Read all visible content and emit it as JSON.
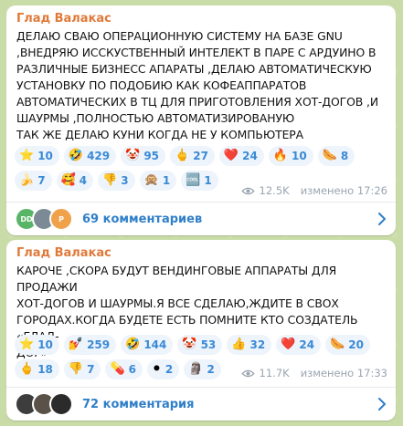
{
  "messages": [
    {
      "author": "Глад Валакас",
      "text": "ДЕЛАЮ СВАЮ ОПЕРАЦИОННУЮ СИСТЕМУ НА БАЗЕ GNU\n,ВНЕДРЯЮ ИССКУСТВЕННЫЙ ИНТЕЛЕКТ В ПАРЕ С АРДУИНО В\nРАЗЛИЧНЫЕ БИЗНЕСС АПАРАТЫ ,ДЕЛАЮ АВТОМАТИЧЕСКУЮ\nУСТАНОВКУ ПО ПОДОБИЮ КАК КОФЕАППАРАТОВ\nАВТОМАТИЧЕСКИХ В ТЦ ДЛЯ ПРИГОТОВЛЕНИЯ ХОТ-ДОГОВ ,И\nШАУРМЫ ,ПОЛНОСТЬЮ АВТОМАТИЗИРОВАНУЮ\nТАК ЖЕ ДЕЛАЮ КУНИ КОГДА НЕ У КОМПЬЮТЕРА",
      "reactions": [
        {
          "emoji": "⭐",
          "count": "10"
        },
        {
          "emoji": "🤣",
          "count": "429"
        },
        {
          "emoji": "🤡",
          "count": "95"
        },
        {
          "emoji": "🖕",
          "count": "27"
        },
        {
          "emoji": "❤️",
          "count": "24"
        },
        {
          "emoji": "🔥",
          "count": "10"
        },
        {
          "emoji": "🌭",
          "count": "8"
        },
        {
          "emoji": "🍌",
          "count": "7"
        },
        {
          "emoji": "🥰",
          "count": "4"
        },
        {
          "emoji": "👎",
          "count": "3"
        },
        {
          "emoji": "🙊",
          "count": "1"
        },
        {
          "emoji": "🆒",
          "count": "1"
        }
      ],
      "views": "12.5K",
      "edited_time": "изменено 17:26",
      "comments_label": "69 комментариев",
      "avatars": [
        {
          "initials": "DD",
          "color": "#58b567"
        },
        {
          "initials": "",
          "color": "#7c8a95"
        },
        {
          "initials": "P",
          "color": "#f0a24a"
        }
      ]
    },
    {
      "author": "Глад Валакас",
      "text": "КАРОЧЕ ,СКОРА БУДУТ ВЕНДИНГОВЫЕ АППАРАТЫ ДЛЯ ПРОДАЖИ\nХОТ-ДОГОВ И ШАУРМЫ.Я ВСЕ СДЕЛАЮ,ЖДИТЕ В СВОХ\nГОРОДАХ.КОГДА БУДЕТЕ ЕСТЬ ПОМНИТЕ КТО СОЗДАТЕЛЬ «ГЛАД-\nДОГ»",
      "reactions": [
        {
          "emoji": "⭐",
          "count": "10"
        },
        {
          "emoji": "💅",
          "count": "259"
        },
        {
          "emoji": "🤣",
          "count": "144"
        },
        {
          "emoji": "🤡",
          "count": "53"
        },
        {
          "emoji": "👍",
          "count": "32"
        },
        {
          "emoji": "❤️",
          "count": "24"
        },
        {
          "emoji": "🌭",
          "count": "20"
        },
        {
          "emoji": "🖕",
          "count": "18"
        },
        {
          "emoji": "👎",
          "count": "7"
        },
        {
          "emoji": "💊",
          "count": "6"
        },
        {
          "emoji": "⚫",
          "count": "2"
        },
        {
          "emoji": "🗿",
          "count": "2"
        }
      ],
      "views": "11.7K",
      "edited_time": "изменено 17:33",
      "comments_label": "72 комментария",
      "avatars": [
        {
          "initials": "",
          "color": "#3d3d3d"
        },
        {
          "initials": "",
          "color": "#5a5248"
        },
        {
          "initials": "",
          "color": "#2b2b2b"
        }
      ]
    }
  ],
  "colors": {
    "author": "#e07a3a",
    "link": "#2f7fc9",
    "reaction_bg": "#eef4fb",
    "reaction_count": "#3a8ad6",
    "meta": "#9aa5b0",
    "chat_bg": "#c9dca8"
  },
  "icons": {
    "views": "eye-icon",
    "comments_chevron": "chevron-right-icon"
  }
}
